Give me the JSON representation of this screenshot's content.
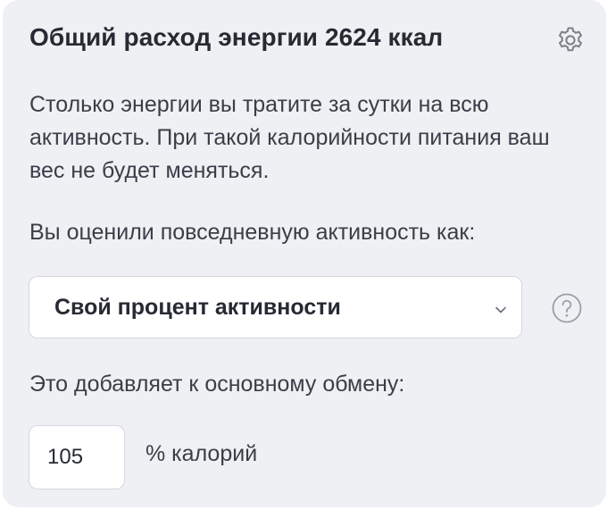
{
  "card": {
    "title": "Общий расход энергии 2624 ккал",
    "settings_icon": "gear-icon",
    "description": "Столько энергии вы тратите за сутки на всю активность. При такой калорийности питания ваш вес не будет меняться.",
    "activity_question": "Вы оценили повседневную активность как:",
    "activity_select": {
      "selected": "Свой процент активности",
      "chevron_icon": "chevron-down-icon"
    },
    "help_icon": "question-circle-icon",
    "adds_label": "Это добавляет к основному обмену:",
    "percent_input": {
      "value": "105"
    },
    "percent_unit": "% калорий"
  },
  "colors": {
    "card_background": "#eef0f3",
    "text_primary": "#262a33",
    "icon_gray": "#7b808a",
    "border": "#d4d7dd"
  }
}
